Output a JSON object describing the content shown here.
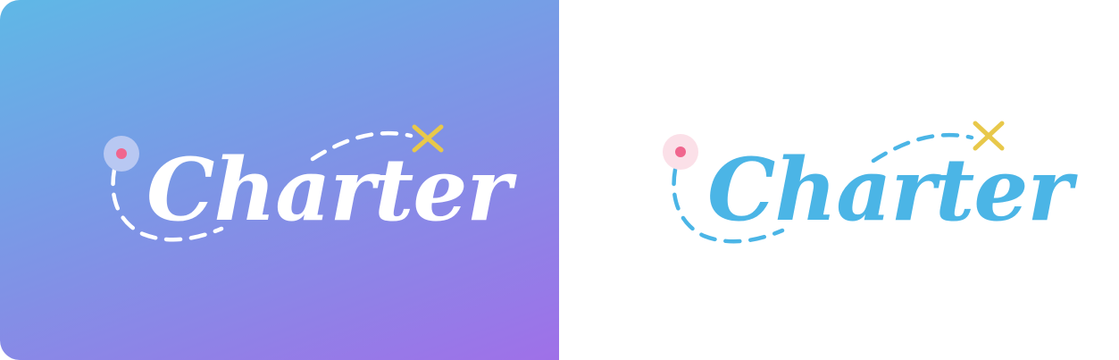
{
  "logo_text": "Charter",
  "variants": [
    {
      "background": "gradient",
      "gradient_colors": [
        "#5fb8e6",
        "#7c97e6",
        "#9f70e8"
      ],
      "text_color": "#ffffff",
      "path_color": "#ffffff",
      "pin_halo_color": "#b8c8f2",
      "pin_dot_color": "#f0668e",
      "x_mark_color": "#e8c84a"
    },
    {
      "background": "#ffffff",
      "text_color": "#4bb5e6",
      "path_color": "#4bb5e6",
      "pin_halo_color": "#fbe0e8",
      "pin_dot_color": "#f0668e",
      "x_mark_color": "#e8c84a"
    }
  ]
}
